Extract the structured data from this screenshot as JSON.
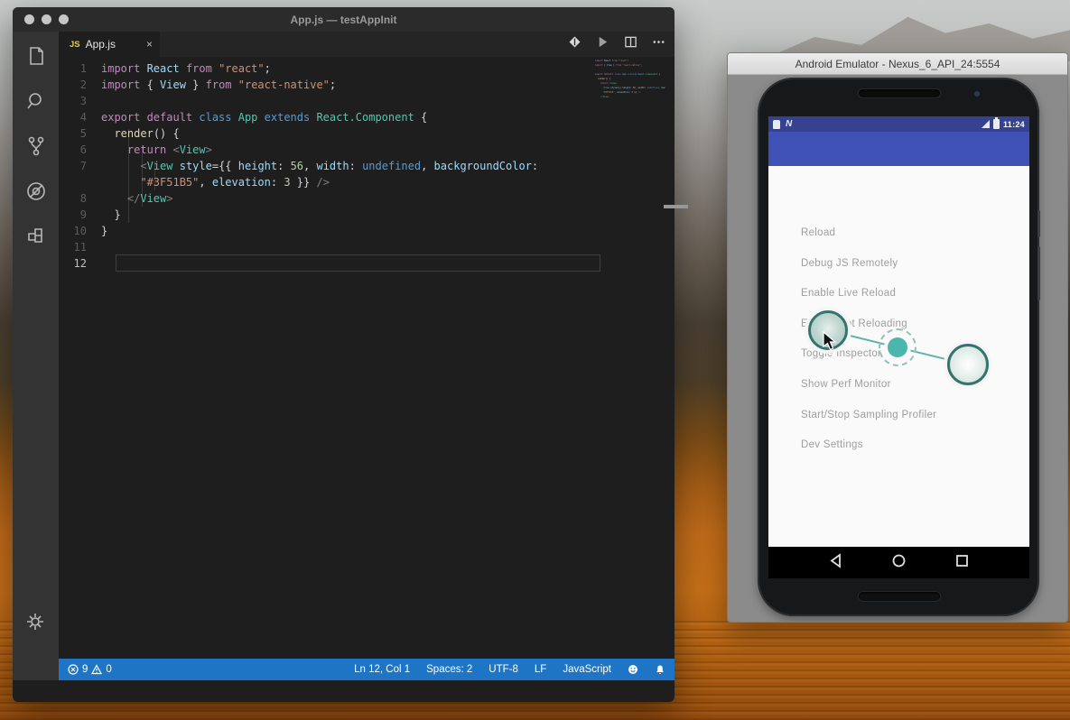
{
  "desktop": {
    "wallpaper": "high-sierra-autumn-mountain"
  },
  "vscode": {
    "window_title": "App.js — testAppInit",
    "tab": {
      "badge": "JS",
      "label": "App.js",
      "close": "×"
    },
    "toolbar_icons": [
      "format-diamond-icon",
      "run-icon",
      "split-editor-icon",
      "more-actions-icon"
    ],
    "activity_bar_icons": [
      "explorer-icon",
      "search-icon",
      "source-control-icon",
      "debug-icon",
      "extensions-icon",
      "settings-gear-icon"
    ],
    "syntax_colors": {
      "kw": "#C586C0",
      "kwb": "#569CD6",
      "typ": "#4EC9B2",
      "varb": "#9CDCFE",
      "attr": "#9CDCFE",
      "str": "#CE9178",
      "num": "#B5CEA8",
      "fn": "#DCDCAA",
      "pun": "#D4D4D4",
      "brk": "#808080"
    },
    "editor": {
      "background": "#1E1E1E",
      "active_line": 12,
      "lines": [
        {
          "n": "1",
          "segs": [
            [
              "import ",
              "kw"
            ],
            [
              "React ",
              "varb"
            ],
            [
              "from ",
              "kw"
            ],
            [
              "\"react\"",
              "str"
            ],
            [
              ";",
              "pun"
            ]
          ]
        },
        {
          "n": "2",
          "segs": [
            [
              "import ",
              "kw"
            ],
            [
              "{ ",
              "pun"
            ],
            [
              "View",
              "varb"
            ],
            [
              " } ",
              "pun"
            ],
            [
              "from ",
              "kw"
            ],
            [
              "\"react-native\"",
              "str"
            ],
            [
              ";",
              "pun"
            ]
          ]
        },
        {
          "n": "3",
          "segs": []
        },
        {
          "n": "4",
          "segs": [
            [
              "export ",
              "kw"
            ],
            [
              "default ",
              "kw"
            ],
            [
              "class ",
              "kwb"
            ],
            [
              "App ",
              "typ"
            ],
            [
              "extends ",
              "kwb"
            ],
            [
              "React.Component ",
              "typ"
            ],
            [
              "{",
              "pun"
            ]
          ]
        },
        {
          "n": "5",
          "segs": [
            [
              "  ",
              "pun"
            ],
            [
              "render",
              "fn"
            ],
            [
              "() {",
              "pun"
            ]
          ]
        },
        {
          "n": "6",
          "segs": [
            [
              "    ",
              "pun"
            ],
            [
              "return ",
              "kw"
            ],
            [
              "<",
              "brk"
            ],
            [
              "View",
              "typ"
            ],
            [
              ">",
              "brk"
            ]
          ]
        },
        {
          "n": "7",
          "segs": [
            [
              "      ",
              "pun"
            ],
            [
              "<",
              "brk"
            ],
            [
              "View ",
              "typ"
            ],
            [
              "style",
              "attr"
            ],
            [
              "=",
              "pun"
            ],
            [
              "{{ ",
              "pun"
            ],
            [
              "height",
              "attr"
            ],
            [
              ": ",
              "pun"
            ],
            [
              "56",
              "num"
            ],
            [
              ", ",
              "pun"
            ],
            [
              "width",
              "attr"
            ],
            [
              ": ",
              "pun"
            ],
            [
              "undefined",
              "kwb"
            ],
            [
              ", ",
              "pun"
            ],
            [
              "backgroundColor",
              "attr"
            ],
            [
              ":",
              "pun"
            ]
          ]
        },
        {
          "n": "",
          "segs": [
            [
              "      ",
              "pun"
            ],
            [
              "\"#3F51B5\"",
              "str"
            ],
            [
              ", ",
              "pun"
            ],
            [
              "elevation",
              "attr"
            ],
            [
              ": ",
              "pun"
            ],
            [
              "3 ",
              "num"
            ],
            [
              "}} ",
              "pun"
            ],
            [
              "/>",
              "brk"
            ]
          ]
        },
        {
          "n": "8",
          "segs": [
            [
              "    ",
              "pun"
            ],
            [
              "</",
              "brk"
            ],
            [
              "View",
              "typ"
            ],
            [
              ">",
              "brk"
            ]
          ]
        },
        {
          "n": "9",
          "segs": [
            [
              "  }",
              "pun"
            ]
          ]
        },
        {
          "n": "10",
          "segs": [
            [
              "}",
              "pun"
            ]
          ]
        },
        {
          "n": "11",
          "segs": []
        },
        {
          "n": "12",
          "segs": [],
          "active": true
        }
      ]
    },
    "status_bar": {
      "background": "#1E75C5",
      "errors": "9",
      "warnings": "0",
      "line_col": "Ln 12, Col 1",
      "spaces": "Spaces: 2",
      "encoding": "UTF-8",
      "eol": "LF",
      "language": "JavaScript",
      "icons": [
        "error-icon",
        "warning-icon",
        "feedback-smiley-icon",
        "notifications-bell-icon"
      ]
    }
  },
  "emulator": {
    "window_title": "Android Emulator - Nexus_6_API_24:5554",
    "colors": {
      "app_bar": "#3F51B5",
      "status_bar": "#344290",
      "content": "#FAFAFA",
      "touch_accent": "#4DB6AC"
    },
    "android_status": {
      "usb_icon": "usb-icon",
      "n_icon": "N",
      "signal_icon": "signal-icon",
      "battery_icon": "battery-charging-icon",
      "time": "11:24"
    },
    "dev_menu_items": [
      "Reload",
      "Debug JS Remotely",
      "Enable Live Reload",
      "Enable Hot Reloading",
      "Toggle Inspector",
      "Show Perf Monitor",
      "Start/Stop Sampling Profiler",
      "Dev Settings"
    ],
    "nav_icons": [
      "back-icon",
      "home-icon",
      "recents-icon"
    ]
  }
}
